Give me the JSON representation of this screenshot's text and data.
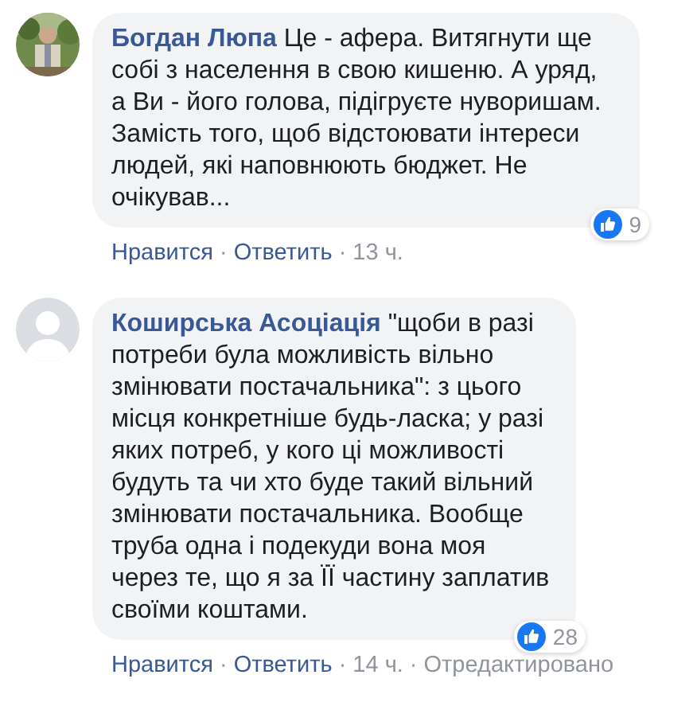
{
  "comments": [
    {
      "author": "Богдан Люпа",
      "text": "Це - афера. Витягнути ще собі з населення в свою кишеню. А уряд, а Ви - його голова, підігруєте нуворишам. Замість того, щоб відстоювати інтереси людей, які наповнюють бюджет. Не очікував...",
      "reactions": "9",
      "actions": [
        {
          "kind": "link",
          "label": "Нравится"
        },
        {
          "kind": "separator",
          "label": "·"
        },
        {
          "kind": "link",
          "label": "Ответить"
        },
        {
          "kind": "separator",
          "label": "·"
        },
        {
          "kind": "meta",
          "label": "13 ч."
        }
      ]
    },
    {
      "author": "Коширська Асоціація",
      "avatar": {
        "kind": "silhouette"
      },
      "text": "\"щоби в разі потреби була можливість вільно змінювати постачальника\": з цього місця конкретніше будь-ласка; у разі яких потреб, у кого ці можливості будуть та чи хто буде такий вільний змінювати постачальника. Вообще труба одна і подекуди вона моя через те, що я за ЇЇ частину заплатив своїми коштами.",
      "reactions": "28",
      "actions": [
        {
          "kind": "link",
          "label": "Нравится"
        },
        {
          "kind": "separator",
          "label": "·"
        },
        {
          "kind": "link",
          "label": "Ответить"
        },
        {
          "kind": "separator",
          "label": "·"
        },
        {
          "kind": "meta",
          "label": "14 ч."
        },
        {
          "kind": "separator",
          "label": "·"
        },
        {
          "kind": "meta",
          "label": "Отредактировано"
        }
      ]
    }
  ]
}
